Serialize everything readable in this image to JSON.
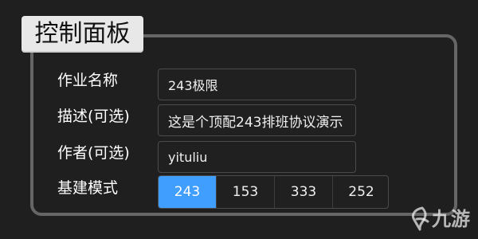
{
  "panel": {
    "title": "控制面板"
  },
  "form": {
    "job_name": {
      "label": "作业名称",
      "value": "243极限"
    },
    "description": {
      "label": "描述(可选)",
      "value": "这是个顶配243排班协议演示"
    },
    "author": {
      "label": "作者(可选)",
      "value": "yituliu"
    },
    "build_mode": {
      "label": "基建模式",
      "options": [
        {
          "label": "243"
        },
        {
          "label": "153"
        },
        {
          "label": "333"
        },
        {
          "label": "252"
        }
      ],
      "selected": "243"
    }
  },
  "watermark": {
    "logo_icon": "jiuyou-logo-icon",
    "text": "九游"
  },
  "colors": {
    "background": "#1f1f1f",
    "frame": "#666666",
    "input_border": "#4b4b4b",
    "accent": "#409eff",
    "title_bg": "#e8e8e8"
  }
}
